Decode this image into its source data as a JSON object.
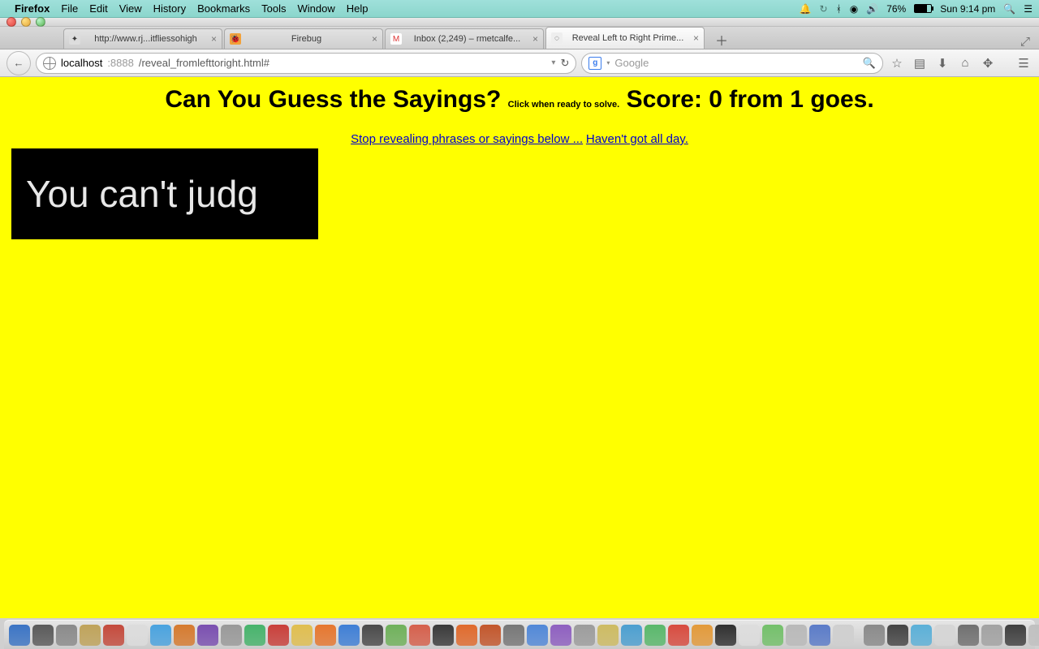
{
  "menubar": {
    "app": "Firefox",
    "items": [
      "File",
      "Edit",
      "View",
      "History",
      "Bookmarks",
      "Tools",
      "Window",
      "Help"
    ],
    "battery_pct": "76%",
    "clock": "Sun 9:14 pm"
  },
  "tabs": [
    {
      "label": "http://www.rj...itfliessohigh",
      "active": false
    },
    {
      "label": "Firebug",
      "active": false
    },
    {
      "label": "Inbox (2,249) – rmetcalfe...",
      "active": false
    },
    {
      "label": "Reveal Left to Right Prime...",
      "active": true
    }
  ],
  "url": {
    "host": "localhost",
    "port": ":8888",
    "path": "/reveal_fromlefttoright.html#"
  },
  "search": {
    "placeholder": "Google"
  },
  "page": {
    "title_part1": "Can You Guess the Sayings? ",
    "title_small": "Click when ready to solve.",
    "title_part2": " Score: 0 from 1 goes.",
    "link_stop": "Stop revealing phrases or sayings below ...",
    "link_fast": "Haven't got all day.",
    "reveal_text": "You can't judg"
  },
  "dock_colors": [
    "#3b74c4",
    "#5a5a5a",
    "#8a8a8a",
    "#bfa35a",
    "#c44a3c",
    "#dcdcdc",
    "#4aa3df",
    "#d67a2e",
    "#7a4fb0",
    "#999999",
    "#46b36b",
    "#c93f3a",
    "#e0be4f",
    "#e6762e",
    "#3f7fd6",
    "#4a4a4a",
    "#6fb15a",
    "#d6604c",
    "#3a3a3a",
    "#e06a2c",
    "#c3562b",
    "#777777",
    "#5188d8",
    "#8e5fc0",
    "#9c9c9c",
    "#cdbb62",
    "#4c9fd0",
    "#59b86b",
    "#d84b3f",
    "#e39a3a",
    "#303030",
    "#dddddd",
    "#73c06a",
    "#b9b9b9",
    "#5a7bc8",
    "#cfcfcf",
    "#8a8a8a",
    "#444444",
    "#5bb0d8",
    "#d6d6d6",
    "#707070",
    "#a2a2a2",
    "#3f3f3f",
    "#c0c0c0",
    "#b0864a",
    "#888888",
    "#5c5c5c",
    "#9d9d9d",
    "#6aa7d8",
    "#cab85e",
    "#7d7d7d",
    "#4e4e4e",
    "#d0d0d0",
    "#b5b5b5",
    "#8fbf6e",
    "#6e6e6e",
    "#a8a8a8",
    "#c7c7c7"
  ]
}
